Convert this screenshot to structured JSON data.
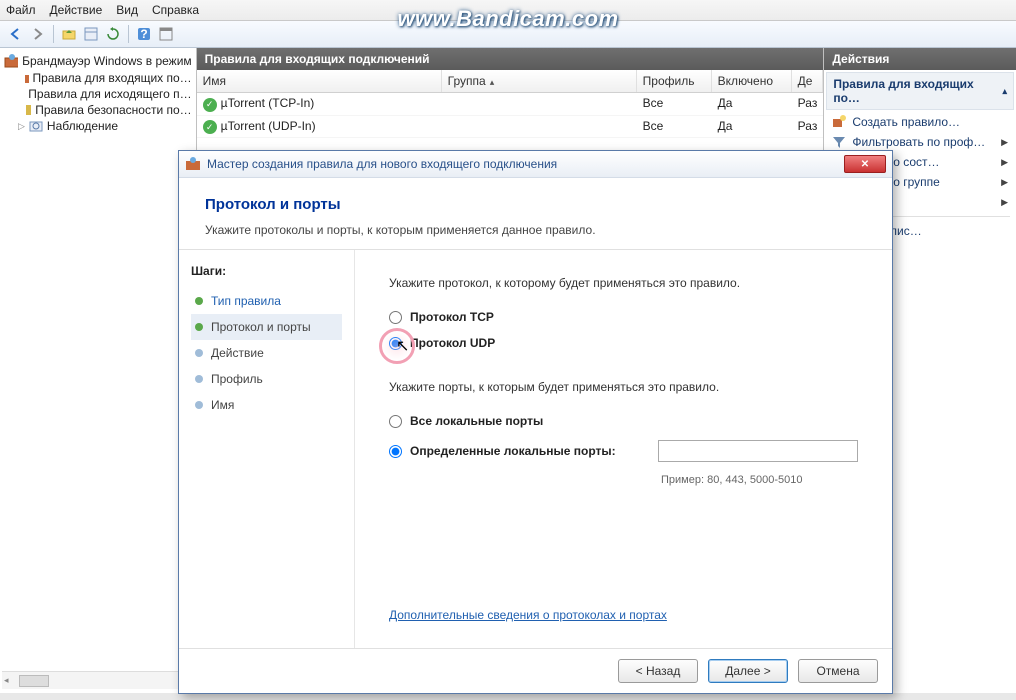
{
  "watermark": "www.Bandicam.com",
  "menubar": {
    "file": "Файл",
    "action": "Действие",
    "view": "Вид",
    "help": "Справка"
  },
  "tree": {
    "root": "Брандмауэр Windows в режим",
    "inbound": "Правила для входящих по…",
    "outbound": "Правила для исходящего п…",
    "security": "Правила безопасности по…",
    "monitoring": "Наблюдение"
  },
  "center": {
    "title": "Правила для входящих подключений",
    "columns": {
      "name": "Имя",
      "group": "Группа",
      "profile": "Профиль",
      "enabled": "Включено",
      "action": "Де"
    },
    "rows": [
      {
        "name": "µTorrent (TCP-In)",
        "group": "",
        "profile": "Все",
        "enabled": "Да",
        "action": "Раз"
      },
      {
        "name": "µTorrent (UDP-In)",
        "group": "",
        "profile": "Все",
        "enabled": "Да",
        "action": "Раз"
      }
    ]
  },
  "actions": {
    "header": "Действия",
    "section": "Правила для входящих по…",
    "create": "Создать правило…",
    "filter_profile": "Фильтровать по проф…",
    "filter_state": "овать по сост…",
    "filter_group": "овать по группе",
    "export": "гировать спис…"
  },
  "wizard": {
    "title": "Мастер создания правила для нового входящего подключения",
    "header": "Протокол и порты",
    "subheader": "Укажите протоколы и порты, к которым применяется данное правило.",
    "steps_label": "Шаги:",
    "steps": {
      "type": "Тип правила",
      "protocol": "Протокол и порты",
      "action": "Действие",
      "profile": "Профиль",
      "name": "Имя"
    },
    "content": {
      "protocol_prompt": "Укажите протокол, к которому будет применяться это правило.",
      "tcp": "Протокол TCP",
      "udp": "Протокол UDP",
      "ports_prompt": "Укажите порты, к которым будет применяться это правило.",
      "all_ports": "Все локальные порты",
      "specific_ports": "Определенные локальные порты:",
      "example": "Пример: 80, 443, 5000-5010",
      "learn_more": "Дополнительные сведения о протоколах и портах"
    },
    "buttons": {
      "back": "< Назад",
      "next": "Далее >",
      "cancel": "Отмена"
    }
  }
}
